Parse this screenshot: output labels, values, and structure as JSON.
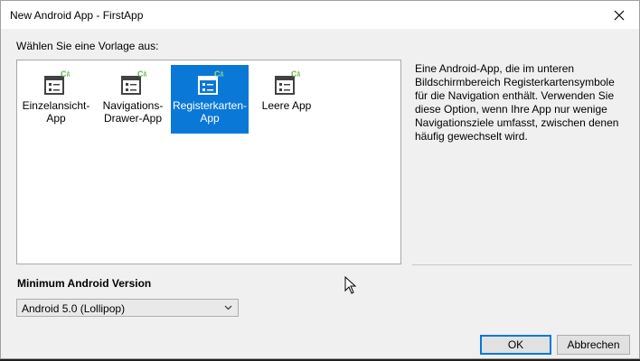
{
  "window": {
    "title": "New Android App - FirstApp",
    "close_icon": "close-icon"
  },
  "prompt": "Wählen Sie eine Vorlage aus:",
  "templates": [
    {
      "label": "Einzelansicht-\nApp",
      "icon": "template-icon",
      "selected": false
    },
    {
      "label": "Navigations-\nDrawer-App",
      "icon": "template-icon",
      "selected": false
    },
    {
      "label": "Registerkarten-\nApp",
      "icon": "template-icon",
      "selected": true
    },
    {
      "label": "Leere App",
      "icon": "template-icon",
      "selected": false
    }
  ],
  "description": "Eine Android-App, die im unteren Bildschirmbereich Registerkartensymbole für die Navigation enthält. Verwenden Sie diese Option, wenn Ihre App nur wenige Navigationsziele umfasst, zwischen denen häufig gewechselt wird.",
  "min_version": {
    "label": "Minimum Android Version",
    "selected": "Android 5.0 (Lollipop)"
  },
  "buttons": {
    "ok": "OK",
    "cancel": "Abbrechen"
  },
  "colors": {
    "accent": "#0a78d7",
    "csharp_badge": "#68b04e"
  }
}
